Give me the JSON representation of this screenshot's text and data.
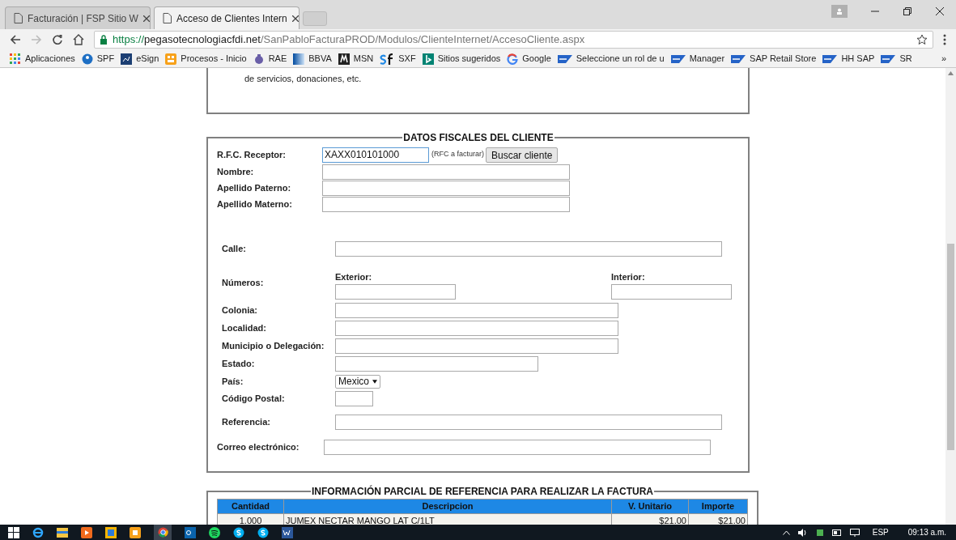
{
  "browser": {
    "tabs": [
      {
        "title": "Facturación | FSP Sitio W",
        "selected": false
      },
      {
        "title": "Acceso de Clientes Intern",
        "selected": true
      }
    ],
    "address": {
      "scheme": "https://",
      "host": "pegasotecnologiacfdi.net",
      "path": "/SanPabloFacturaPROD/Modulos/ClienteInternet/AccesoCliente.aspx"
    },
    "bookmarks": [
      {
        "label": "Aplicaciones",
        "kind": "apps"
      },
      {
        "label": "SPF",
        "kind": "globe"
      },
      {
        "label": "eSign",
        "kind": "esign"
      },
      {
        "label": "Procesos - Inicio",
        "kind": "procesos"
      },
      {
        "label": "RAE",
        "kind": "rae"
      },
      {
        "label": "BBVA",
        "kind": "bbva"
      },
      {
        "label": "MSN",
        "kind": "msn"
      },
      {
        "label": "SXF",
        "kind": "sf"
      },
      {
        "label": "Sitios sugeridos",
        "kind": "bing"
      },
      {
        "label": "Google",
        "kind": "google"
      },
      {
        "label": "Seleccione un rol de u",
        "kind": "sap"
      },
      {
        "label": "Manager",
        "kind": "sap"
      },
      {
        "label": "SAP Retail Store",
        "kind": "sap"
      },
      {
        "label": "HH SAP",
        "kind": "sap"
      },
      {
        "label": "SR",
        "kind": "sap"
      }
    ],
    "bookmarks_overflow": "»"
  },
  "intro": {
    "text": "de servicios, donaciones, etc."
  },
  "client_section": {
    "title": "DATOS FISCALES DEL CLIENTE",
    "rfc": {
      "label": "R.F.C. Receptor:",
      "value": "XAXX010101000",
      "hint": "(RFC a facturar)",
      "button": "Buscar cliente"
    },
    "name_fields": [
      {
        "label": "Nombre:"
      },
      {
        "label": "Apellido Paterno:"
      },
      {
        "label": "Apellido Materno:"
      }
    ],
    "address_fields": [
      {
        "label": "Calle:",
        "kind": "long"
      },
      {
        "label": "Números:",
        "kind": "numbers",
        "exterior": "Exterior:",
        "interior": "Interior:"
      },
      {
        "label": "Colonia:",
        "kind": "medium"
      },
      {
        "label": "Localidad:",
        "kind": "medium"
      },
      {
        "label": "Municipio o Delegación:",
        "kind": "medium"
      },
      {
        "label": "Estado:",
        "kind": "short"
      },
      {
        "label": "País:",
        "kind": "select",
        "value": "Mexico"
      },
      {
        "label": "Código Postal:",
        "kind": "tiny"
      },
      {
        "label": "Referencia:",
        "kind": "long"
      }
    ],
    "email": {
      "label": "Correo electrónico:"
    }
  },
  "invoice_section": {
    "title": "INFORMACIÓN PARCIAL DE REFERENCIA PARA REALIZAR LA FACTURA",
    "table": {
      "columns": [
        "Cantidad",
        "Descripcion",
        "V. Unitario",
        "Importe"
      ],
      "rows": [
        [
          "1.000",
          "JUMEX NECTAR MANGO LAT C/1LT",
          "$21.00",
          "$21.00"
        ]
      ]
    }
  },
  "taskbar": {
    "language": "ESP",
    "time": "09:13 a.m."
  }
}
